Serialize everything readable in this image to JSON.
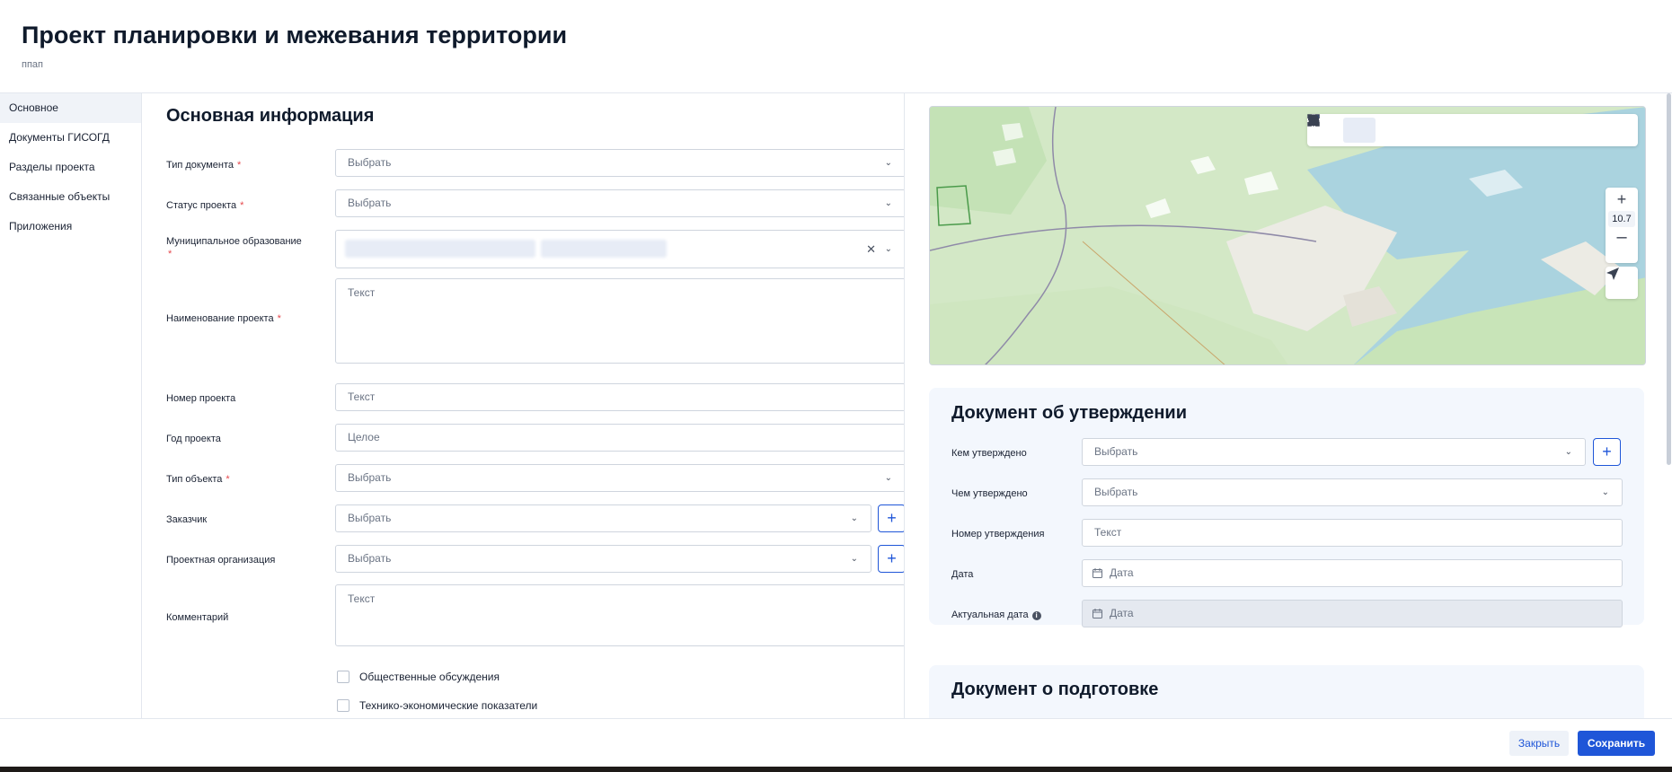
{
  "header": {
    "title": "Проект планировки и межевания территории",
    "subtitle": "ппап"
  },
  "sidebar": {
    "items": [
      {
        "label": "Основное",
        "active": true
      },
      {
        "label": "Документы ГИСОГД"
      },
      {
        "label": "Разделы проекта"
      },
      {
        "label": "Связанные объекты"
      },
      {
        "label": "Приложения"
      }
    ]
  },
  "main": {
    "section_title": "Основная информация",
    "fields": {
      "doc_type": {
        "label": "Тип документа",
        "placeholder": "Выбрать"
      },
      "status": {
        "label": "Статус проекта",
        "placeholder": "Выбрать"
      },
      "municipality": {
        "label": "Муниципальное образование"
      },
      "project_name": {
        "label": "Наименование проекта",
        "placeholder": "Текст"
      },
      "project_number": {
        "label": "Номер проекта",
        "placeholder": "Текст"
      },
      "project_year": {
        "label": "Год проекта",
        "placeholder": "Целое"
      },
      "object_type": {
        "label": "Тип объекта",
        "placeholder": "Выбрать"
      },
      "customer": {
        "label": "Заказчик",
        "placeholder": "Выбрать"
      },
      "design_org": {
        "label": "Проектная организация",
        "placeholder": "Выбрать"
      },
      "comment": {
        "label": "Комментарий",
        "placeholder": "Текст"
      }
    },
    "checkboxes": {
      "public_discussion": "Общественные обсуждения",
      "tech_indicators": "Технико-экономические показатели"
    }
  },
  "map": {
    "zoom": "10.7"
  },
  "approval": {
    "title": "Документ об утверждении",
    "approved_by": {
      "label": "Кем утверждено",
      "placeholder": "Выбрать"
    },
    "approved_with": {
      "label": "Чем утверждено",
      "placeholder": "Выбрать"
    },
    "number": {
      "label": "Номер утверждения",
      "placeholder": "Текст"
    },
    "date": {
      "label": "Дата",
      "placeholder": "Дата"
    },
    "actual_date": {
      "label": "Актуальная дата",
      "placeholder": "Дата"
    }
  },
  "preparation": {
    "title": "Документ о подготовке"
  },
  "footer": {
    "close": "Закрыть",
    "save": "Сохранить"
  },
  "colors": {
    "accent": "#1f56d8",
    "required": "#e5484d"
  }
}
